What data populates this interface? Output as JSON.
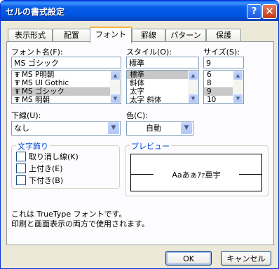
{
  "window": {
    "title": "セルの書式設定",
    "help": "?",
    "close": "✕"
  },
  "tabs": [
    "表示形式",
    "配置",
    "フォント",
    "罫線",
    "パターン",
    "保護"
  ],
  "font": {
    "label": "フォント名(F):",
    "value": "MS ゴシック",
    "items": [
      "MS P明朝",
      "MS UI Gothic",
      "MS ゴシック",
      "MS 明朝"
    ],
    "selected": 2
  },
  "style": {
    "label": "スタイル(O):",
    "value": "標準",
    "items": [
      "標準",
      "斜体",
      "太字",
      "太字 斜体"
    ],
    "selected": 0
  },
  "size": {
    "label": "サイズ(S):",
    "value": "9",
    "items": [
      "6",
      "8",
      "9",
      "10"
    ],
    "selected": 2
  },
  "underline": {
    "label": "下線(U):",
    "value": "なし"
  },
  "color": {
    "label": "色(C):",
    "value": "自動"
  },
  "effects": {
    "title": "文字飾り",
    "items": [
      "取り消し線(K)",
      "上付き(E)",
      "下付き(B)"
    ]
  },
  "preview": {
    "title": "プレビュー",
    "sample": "Aaあぁｱｧ亜宇"
  },
  "info": {
    "line1": "これは TrueType フォントです。",
    "line2": "印刷と画面表示の両方で使用されます。"
  },
  "buttons": {
    "ok": "OK",
    "cancel": "キャンセル"
  },
  "colors": {
    "titlebar": "#0054e3",
    "selection": "#c8c8c8",
    "group_title": "#0046d5"
  }
}
